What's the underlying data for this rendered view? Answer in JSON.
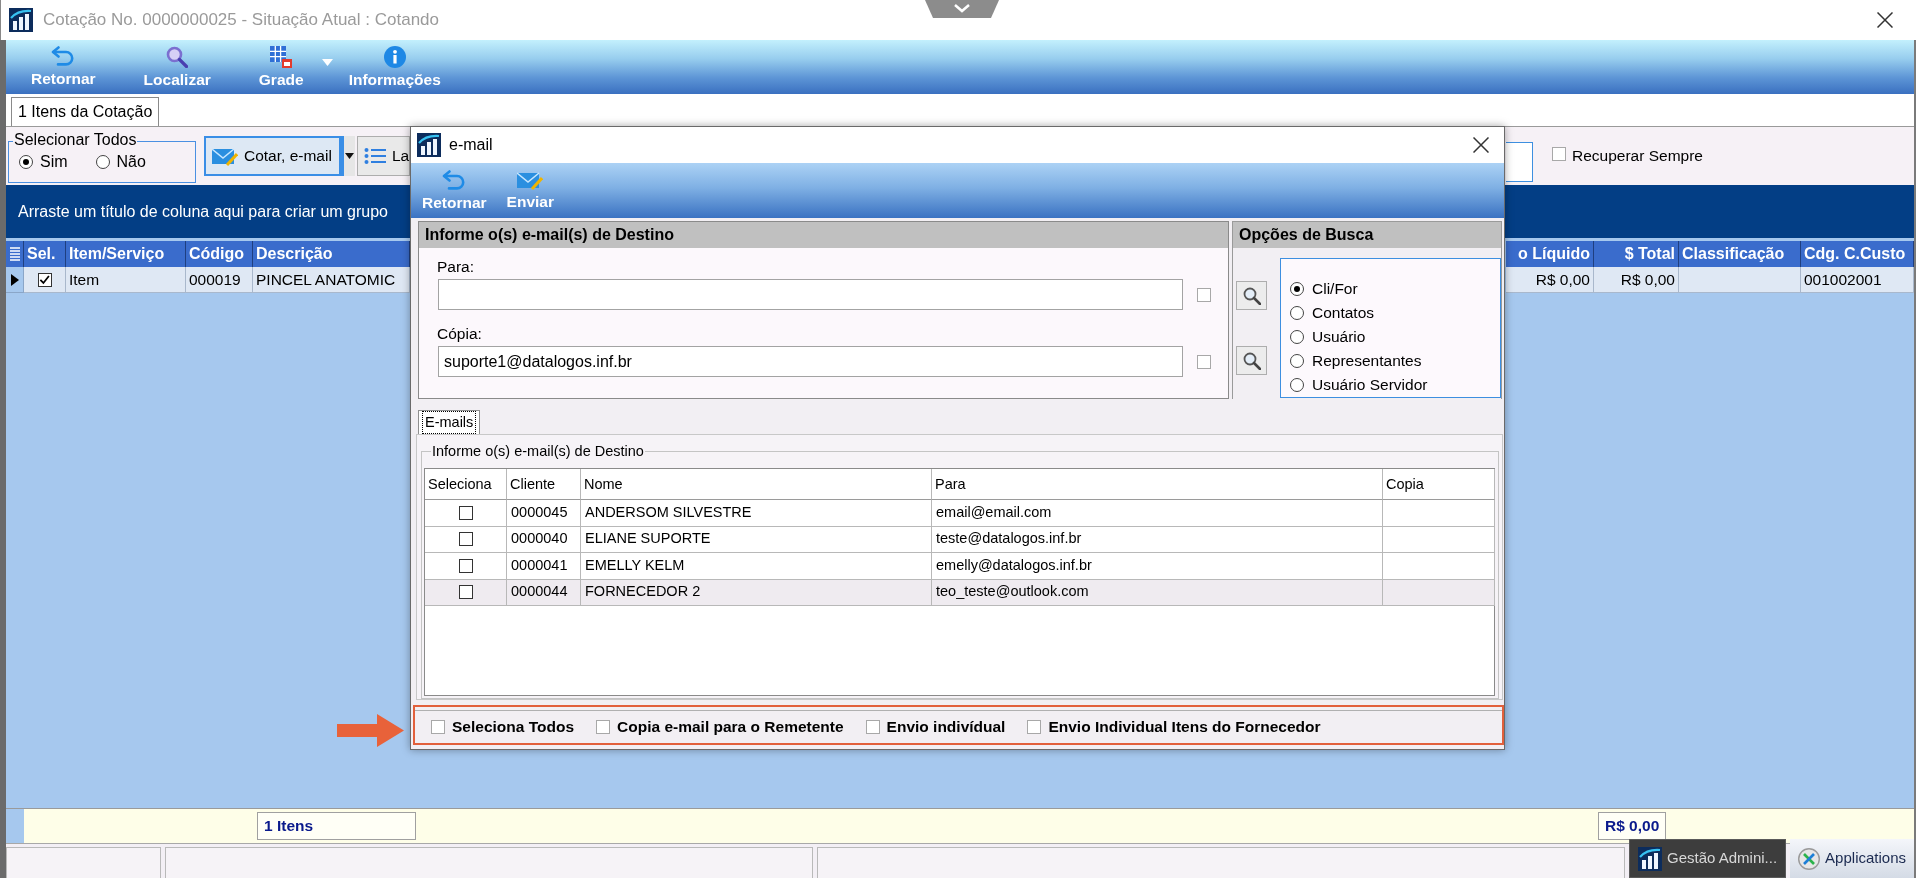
{
  "window": {
    "title": "Cotação No. 0000000025 - Situação Atual : Cotando"
  },
  "toolbar": [
    {
      "label": "Retornar",
      "kind": "undo",
      "dropdown": false
    },
    {
      "label": "Localizar",
      "kind": "search",
      "dropdown": false
    },
    {
      "label": "Grade",
      "kind": "grid",
      "dropdown": true
    },
    {
      "label": "Informações",
      "kind": "info",
      "dropdown": false
    }
  ],
  "tabs": [
    {
      "label": "1 Itens da Cotação",
      "selected": true
    }
  ],
  "select_all": {
    "title": "Selecionar Todos",
    "options": [
      {
        "label": "Sim",
        "selected": true
      },
      {
        "label": "Não",
        "selected": false
      }
    ]
  },
  "actions": [
    {
      "label": "Cotar, e-mail",
      "kind": "mail",
      "split": true,
      "focused": true
    },
    {
      "label": "La",
      "kind": "list",
      "split": false,
      "focused": false
    }
  ],
  "recover_always": {
    "label": "Recuperar Sempre",
    "checked": false
  },
  "group_panel": {
    "hint": "Arraste um título de coluna aqui para criar um grupo"
  },
  "grid": {
    "columns_left": [
      "Sel.",
      "Item/Serviço",
      "Código",
      "Descrição"
    ],
    "columns_right": [
      "o Líquido",
      "$ Total",
      "Classificação",
      "Cdg. C.Custo"
    ],
    "rows": [
      {
        "selected": true,
        "checked": true,
        "item": "Item",
        "code": "000019",
        "description": "PINCEL ANATOMIC",
        "liquido": "R$ 0,00",
        "total": "R$ 0,00",
        "cost_center": "001002001"
      }
    ]
  },
  "footer": {
    "count": "1 Itens",
    "total": "R$ 0,00"
  },
  "taskbar": [
    {
      "label": "Gestão Admini...",
      "kind": "app",
      "selected": true
    },
    {
      "label": "Applications",
      "kind": "apps",
      "selected": false
    }
  ],
  "dialog": {
    "title": "e-mail",
    "toolbar": [
      {
        "label": "Retornar",
        "kind": "undo"
      },
      {
        "label": "Enviar",
        "kind": "mail"
      }
    ],
    "destination": {
      "title": "Informe o(s) e-mail(s) de Destino",
      "fields": [
        {
          "label": "Para:",
          "checked": false
        },
        {
          "label": "Cópia:",
          "value": "suporte1@datalogos.inf.br",
          "checked": false
        }
      ]
    },
    "search_options": {
      "title": "Opções de Busca",
      "options": [
        {
          "label": "Cli/For",
          "selected": true
        },
        {
          "label": "Contatos",
          "selected": false
        },
        {
          "label": "Usuário",
          "selected": false
        },
        {
          "label": "Representantes",
          "selected": false
        },
        {
          "label": "Usuário Servidor",
          "selected": false
        }
      ]
    },
    "tabs": [
      {
        "label": "E-mails",
        "selected": true
      }
    ],
    "list": {
      "title": "Informe o(s) e-mail(s) de Destino",
      "columns": [
        "Seleciona",
        "Cliente",
        "Nome",
        "Para",
        "Copia"
      ],
      "rows": [
        {
          "checked": false,
          "selected": false,
          "cells": [
            "",
            "0000045",
            "ANDERSOM SILVESTRE",
            "email@email.com",
            ""
          ]
        },
        {
          "checked": false,
          "selected": false,
          "cells": [
            "",
            "0000040",
            "ELIANE SUPORTE",
            "teste@datalogos.inf.br",
            ""
          ]
        },
        {
          "checked": false,
          "selected": false,
          "cells": [
            "",
            "0000041",
            "EMELLY KELM",
            "emelly@datalogos.inf.br",
            ""
          ]
        },
        {
          "checked": false,
          "selected": true,
          "cells": [
            "",
            "0000044",
            "FORNECEDOR 2",
            "teo_teste@outlook.com",
            ""
          ]
        }
      ]
    },
    "options": [
      {
        "label": "Seleciona Todos",
        "checked": false
      },
      {
        "label": "Copia e-mail para o Remetente",
        "checked": false
      },
      {
        "label": "Envio indivídual",
        "checked": false
      },
      {
        "label": "Envio Individual Itens do Fornecedor",
        "checked": false
      }
    ]
  }
}
